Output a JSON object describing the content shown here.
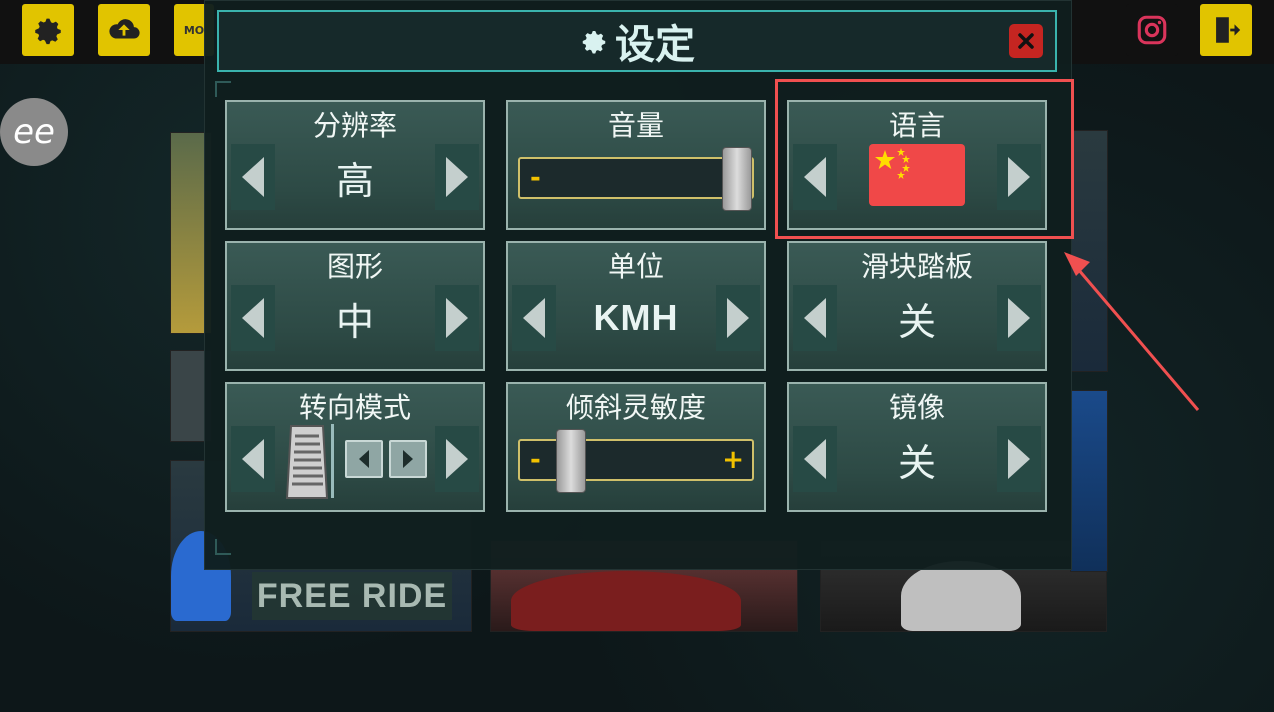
{
  "topbar": {
    "icons": [
      "gear-icon",
      "cloud-upload-icon",
      "mods-icon",
      "instagram-icon",
      "exit-door-icon"
    ],
    "mods_label": "MO"
  },
  "background": {
    "free_ride_label": "FREE RIDE",
    "ee_logo": "ee"
  },
  "settings": {
    "title": "设定",
    "title_icon": "gear-icon",
    "close_icon": "close-icon",
    "tiles": {
      "resolution": {
        "label": "分辨率",
        "value": "高"
      },
      "volume": {
        "label": "音量",
        "minus": "-",
        "plus": "+",
        "level": 1.0
      },
      "language": {
        "label": "语言",
        "flag": "china-flag-icon"
      },
      "graphics": {
        "label": "图形",
        "value": "中"
      },
      "units": {
        "label": "单位",
        "value": "KMH"
      },
      "slider_pedal": {
        "label": "滑块踏板",
        "value": "关"
      },
      "steering_mode": {
        "label": "转向模式",
        "icon": "pedal-icon"
      },
      "tilt_sensitivity": {
        "label": "倾斜灵敏度",
        "minus": "-",
        "plus": "+",
        "level": 0.18
      },
      "mirror": {
        "label": "镜像",
        "value": "关"
      }
    }
  },
  "colors": {
    "accent_teal": "#3ab3ad",
    "close_red": "#c52521",
    "highlight_red": "#f05050",
    "slider_yellow": "#f2c200",
    "topbar_yellow": "#e1c400"
  }
}
